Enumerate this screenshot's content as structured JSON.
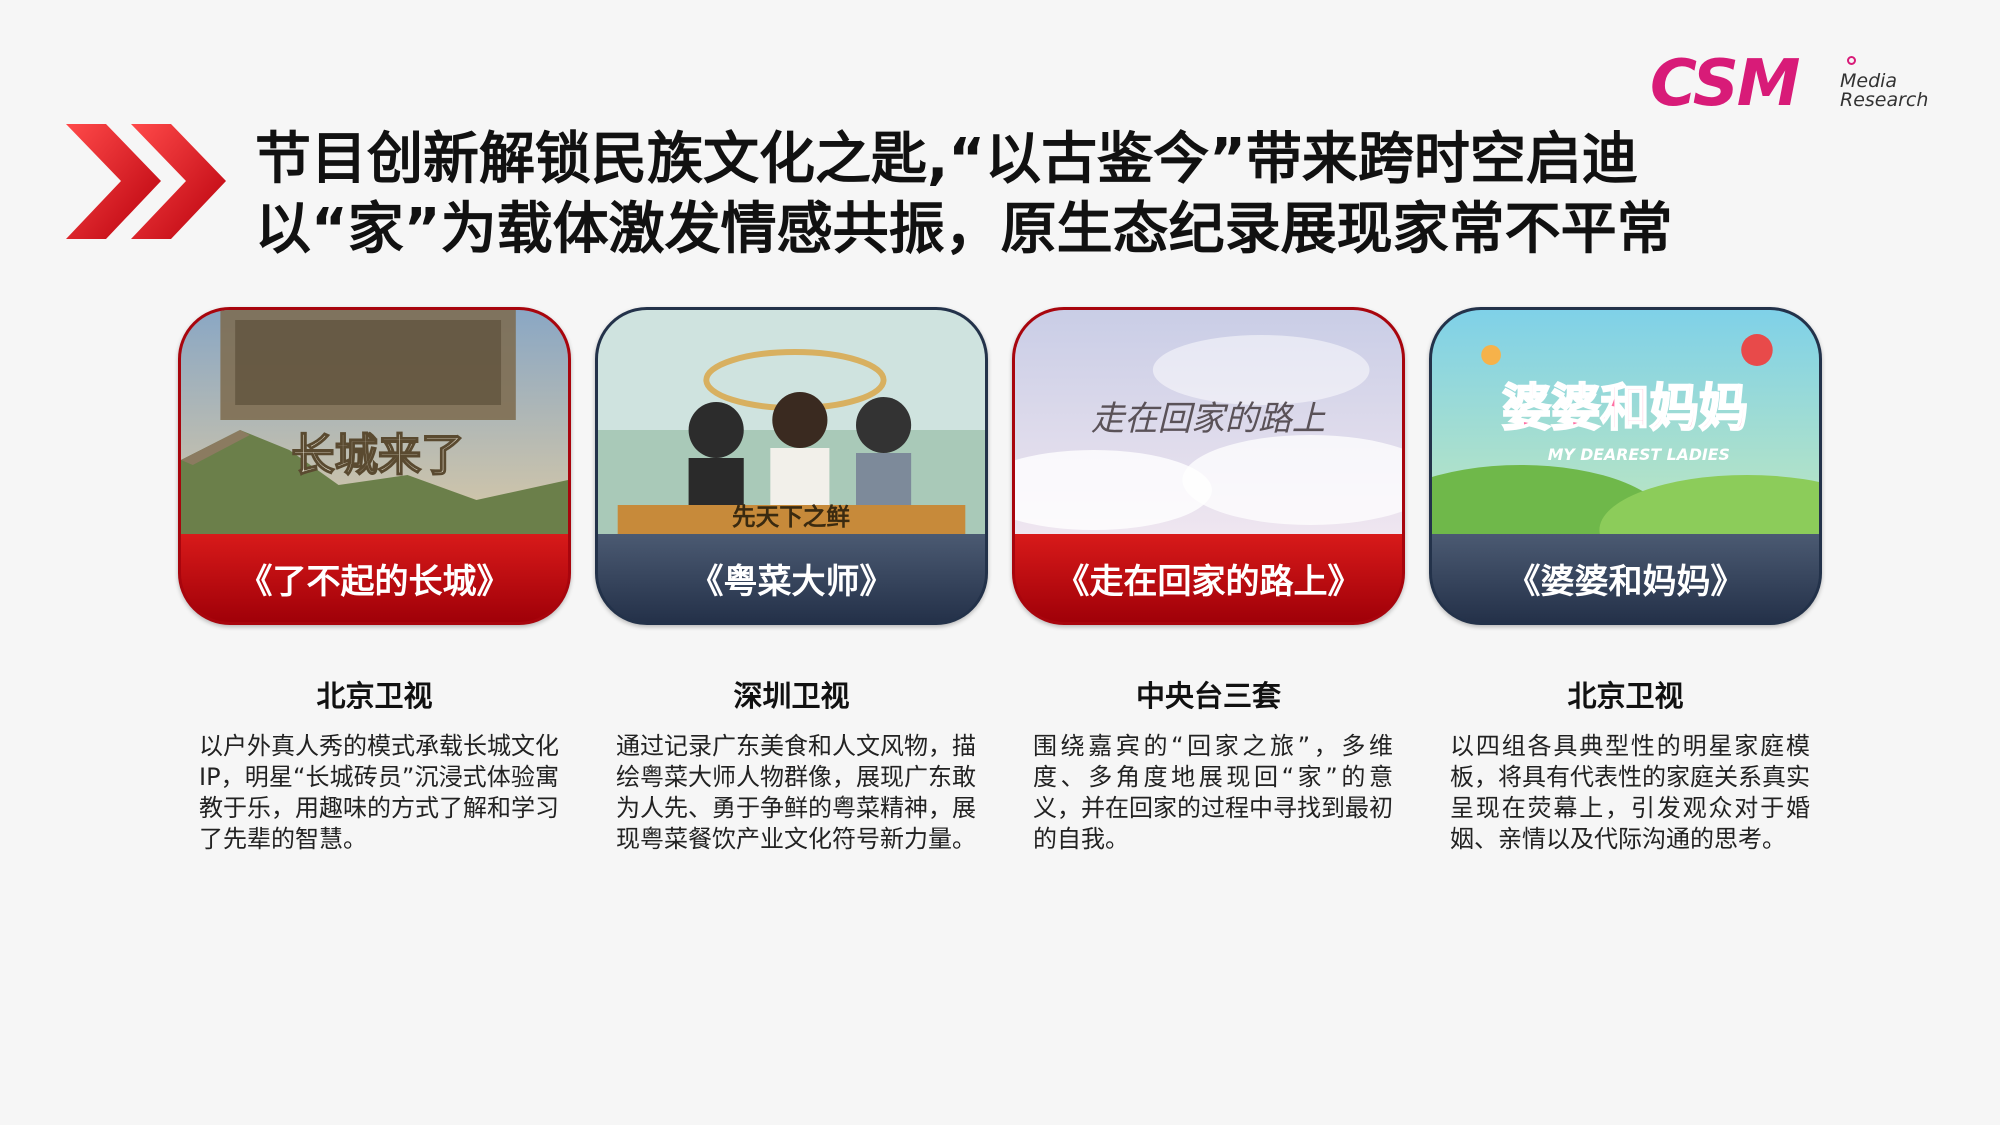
{
  "logo": {
    "mark": "CSM",
    "line1": "Media",
    "line2": "Research"
  },
  "title": {
    "line1": "节目创新解锁民族文化之匙,“以古鉴今”带来跨时空启迪",
    "line2": "以“家”为载体激发情感共振，原生态纪录展现家常不平常"
  },
  "colors": {
    "accent_red": "#d81a1a",
    "dark_navy": "#2c3a52",
    "logo_pink": "#d81b78"
  },
  "programs": [
    {
      "name": "《了不起的长城》",
      "channel": "北京卫视",
      "description": "以户外真人秀的模式承载长城文化IP，明星“长城砖员”沉浸式体验寓教于乐，用趣味的方式了解和学习了先辈的智慧。",
      "poster_text": "长城来了",
      "style": "red"
    },
    {
      "name": "《粤菜大师》",
      "channel": "深圳卫视",
      "description": "通过记录广东美食和人文风物，描绘粤菜大师人物群像，展现广东敢为人先、勇于争鲜的粤菜精神，展现粤菜餐饮产业文化符号新力量。",
      "poster_text": "先天下之鲜",
      "style": "dark"
    },
    {
      "name": "《走在回家的路上》",
      "channel": "中央台三套",
      "description": "围绕嘉宾的“回家之旅”，多维度、多角度地展现回“家”的意义，并在回家的过程中寻找到最初的自我。",
      "poster_text": "走在回家的路上",
      "style": "red"
    },
    {
      "name": "《婆婆和妈妈》",
      "channel": "北京卫视",
      "description": "以四组各具典型性的明星家庭模板，将具有代表性的家庭关系真实呈现在荧幕上，引发观众对于婚姻、亲情以及代际沟通的思考。",
      "poster_text": "婆婆和妈妈",
      "poster_subtext": "MY DEAREST LADIES",
      "style": "dark"
    }
  ]
}
